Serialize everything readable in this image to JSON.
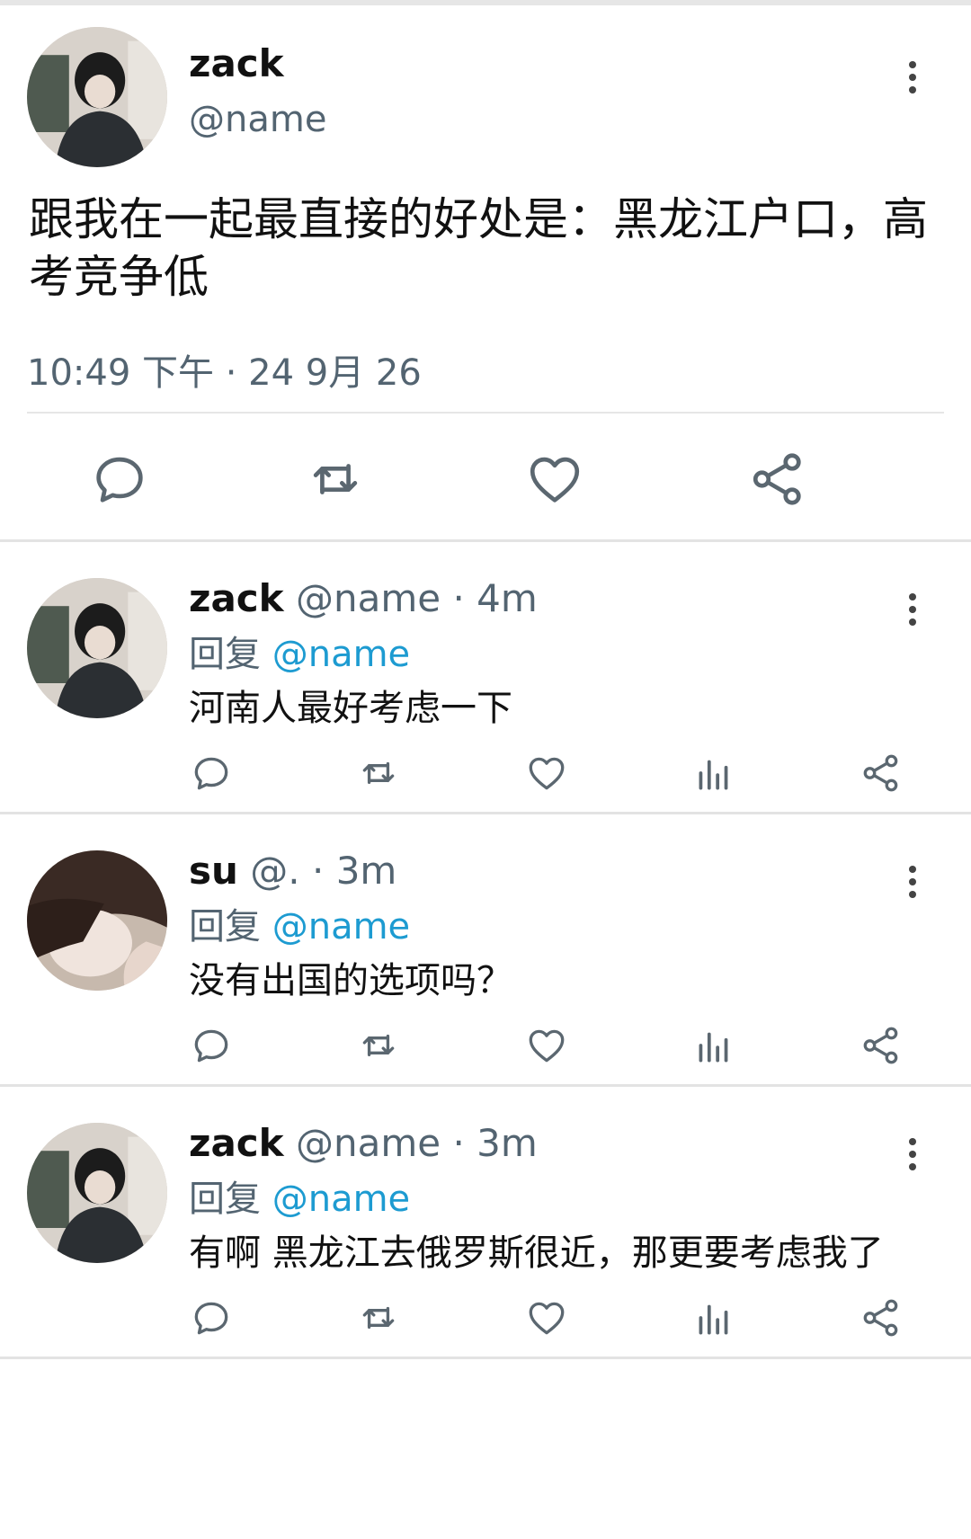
{
  "main_post": {
    "author": {
      "name": "zack",
      "handle": "@name"
    },
    "text": "跟我在一起最直接的好处是：黑龙江户口，高考竞争低",
    "timestamp": "10:49 下午 · 24 9月 26"
  },
  "replies": [
    {
      "name": "zack",
      "handle": "@name",
      "separator": "·",
      "time": "4m",
      "reply_prefix": "回复",
      "reply_to": "@name",
      "text": "河南人最好考虑一下"
    },
    {
      "name": "su",
      "handle": "@.",
      "separator": "·",
      "time": "3m",
      "reply_prefix": "回复",
      "reply_to": "@name",
      "text": "没有出国的选项吗？"
    },
    {
      "name": "zack",
      "handle": "@name",
      "separator": "·",
      "time": "3m",
      "reply_prefix": "回复",
      "reply_to": "@name",
      "text": "有啊 黑龙江去俄罗斯很近，那更要考虑我了"
    }
  ],
  "icons": {
    "reply": "comment-bubble-icon",
    "retweet": "retweet-icon",
    "like": "heart-icon",
    "views": "bar-chart-icon",
    "share": "share-icon",
    "more": "more-vertical-icon"
  },
  "colors": {
    "mention": "#1d9bd1",
    "secondary_text": "#536471",
    "icon": "#5b6770"
  }
}
